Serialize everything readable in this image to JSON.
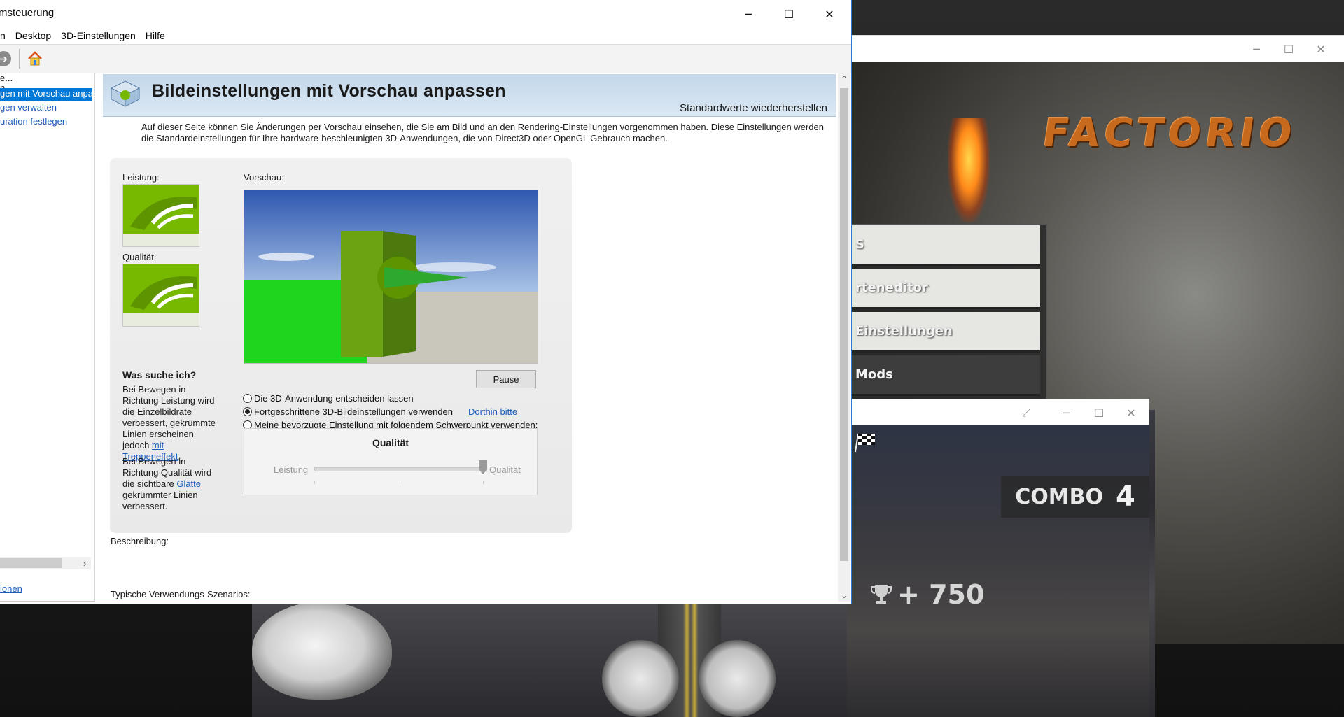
{
  "nvidia_window": {
    "title": "msteuerung",
    "menu": [
      "n",
      "Desktop",
      "3D-Einstellungen",
      "Hilfe"
    ],
    "window_buttons": {
      "minimize": "─",
      "maximize": "☐",
      "close": "✕"
    },
    "toolbar": {
      "forward_icon": "arrow-right-icon",
      "home_icon": "home-icon"
    },
    "tree": {
      "top_item": "e...",
      "partial_item": "n",
      "selected_item": "gen mit Vorschau anpas",
      "item_2": "gen verwalten",
      "item_3": "uration festlegen",
      "bottom_link": "ionen",
      "scroll_right": "›"
    },
    "page": {
      "title": "Bildeinstellungen mit Vorschau anpassen",
      "restore_defaults": "Standardwerte wiederherstellen",
      "intro": "Auf dieser Seite können Sie Änderungen per Vorschau einsehen, die Sie am Bild und an den Rendering-Einstellungen vorgenommen haben. Diese Einstellungen werden die Standardeinstellungen für Ihre hardware-beschleunigten 3D-Anwendungen, die von Direct3D oder OpenGL Gebrauch machen.",
      "performance_label": "Leistung:",
      "quality_label": "Qualität:",
      "preview_label": "Vorschau:",
      "help_heading": "Was suche ich?",
      "help_1_prefix": "Bei Bewegen in Richtung Leistung wird die Einzelbildrate verbessert, gekrümmte Linien erscheinen jedoch ",
      "help_1_link": "mit Treppeneffekt",
      "help_1_suffix": ".",
      "help_2_prefix": "Bei Bewegen in Richtung Qualität wird die sichtbare ",
      "help_2_link": "Glätte",
      "help_2_suffix": " gekrümmter Linien verbessert.",
      "pause_button": "Pause",
      "radio_options": [
        {
          "label": "Die 3D-Anwendung entscheiden lassen",
          "selected": false
        },
        {
          "label": "Fortgeschrittene 3D-Bildeinstellungen verwenden",
          "selected": true,
          "link": "Dorthin bitte"
        },
        {
          "label": "Meine bevorzugte Einstellung mit folgendem Schwerpunkt verwenden:",
          "selected": false
        }
      ],
      "slider": {
        "heading": "Qualität",
        "left_label": "Leistung",
        "right_label": "Qualität",
        "value_fraction": 1.0,
        "enabled": false
      },
      "description_label": "Beschreibung:",
      "typical_label": "Typische Verwendungs-Szenarios:"
    },
    "colors": {
      "accent": "#0078d7",
      "link": "#1d5dbb",
      "header": "#c3d7ea"
    }
  },
  "factorio_window": {
    "logo": "FACTORIO",
    "menu": [
      "S",
      "rteneditor",
      "Einstellungen",
      "Mods"
    ],
    "window_buttons": {
      "minimize": "─",
      "maximize": "☐",
      "close": "✕"
    }
  },
  "moto_window": {
    "window_buttons": {
      "expand": "⤢",
      "minimize": "─",
      "maximize": "☐",
      "close": "✕"
    },
    "combo_label": "COMBO",
    "combo_value": "4",
    "score": "+ 750",
    "score_icon": "trophy-icon",
    "bike_icon": "motorbike-icon"
  }
}
